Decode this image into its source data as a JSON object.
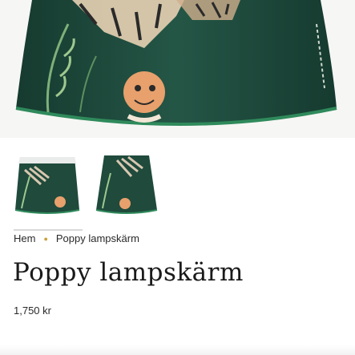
{
  "product": {
    "title": "Poppy lampskärm",
    "price": "1,750 kr",
    "image_alt": "Poppy lampskärm"
  },
  "breadcrumb": {
    "home": "Hem",
    "current": "Poppy lampskärm"
  },
  "gallery": {
    "thumbnails": [
      "thumb-1",
      "thumb-2"
    ],
    "active_index": 0
  },
  "colors": {
    "shade_green": "#1f4a3c",
    "trim_green": "#2f8a5b",
    "tiger_orange": "#e8a06c",
    "accent_gold": "#c9a13a"
  }
}
